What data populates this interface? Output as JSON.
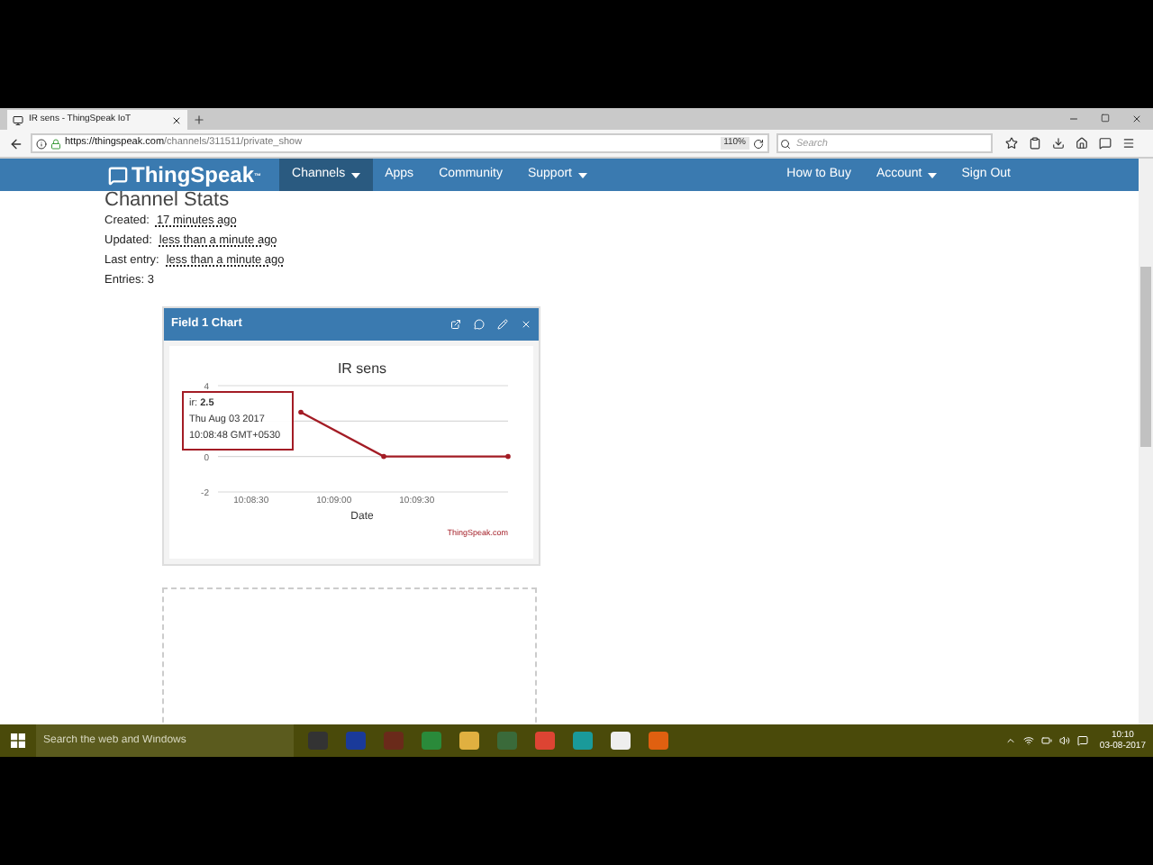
{
  "browser": {
    "tab_title": "IR sens - ThingSpeak IoT",
    "url_host": "https://thingspeak.com",
    "url_path": "/channels/311511/private_show",
    "zoom": "110%",
    "search": {
      "placeholder": "Search"
    }
  },
  "nav": {
    "logo": "ThingSpeak",
    "logo_mark": "™",
    "items": [
      {
        "label": "Channels",
        "dropdown": true,
        "selected": true
      },
      {
        "label": "Apps",
        "dropdown": false,
        "selected": false
      },
      {
        "label": "Community",
        "dropdown": false,
        "selected": false
      },
      {
        "label": "Support",
        "dropdown": true,
        "selected": false
      }
    ],
    "right_items": [
      {
        "label": "How to Buy",
        "dropdown": false
      },
      {
        "label": "Account",
        "dropdown": true
      },
      {
        "label": "Sign Out",
        "dropdown": false
      }
    ]
  },
  "channel_stats": {
    "heading": "Channel Stats",
    "rows": [
      {
        "label": "Created:",
        "value": "17 minutes ago"
      },
      {
        "label": "Updated:",
        "value": "less than a minute ago"
      },
      {
        "label": "Last entry:",
        "value": "less than a minute ago"
      },
      {
        "label": "Entries: 3"
      }
    ]
  },
  "chart_card": {
    "title": "Field 1 Chart",
    "credit": "ThingSpeak.com",
    "tooltip": [
      "ir: **2.5**",
      "Thu Aug 03 2017",
      "10:08:48 GMT+0530"
    ],
    "chart_data": {
      "type": "line",
      "title": "IR sens",
      "xlabel": "Date",
      "x": [
        36528,
        36558,
        36603
      ],
      "series": [
        {
          "color": "#a31c25",
          "values": [
            2.5,
            0,
            0
          ]
        }
      ],
      "xlim": [
        36498,
        36603
      ],
      "ylim": [
        -2,
        4
      ],
      "xticks": [
        {
          "value": 36510,
          "label": "10:08:30"
        },
        {
          "value": 36540,
          "label": "10:09:00"
        },
        {
          "value": 36570,
          "label": "10:09:30"
        }
      ],
      "yticks": [
        -2,
        0,
        4
      ]
    }
  },
  "taskbar": {
    "search": {
      "placeholder": "Search the web and Windows"
    },
    "time": "10:10",
    "date": "03-08-2017"
  }
}
